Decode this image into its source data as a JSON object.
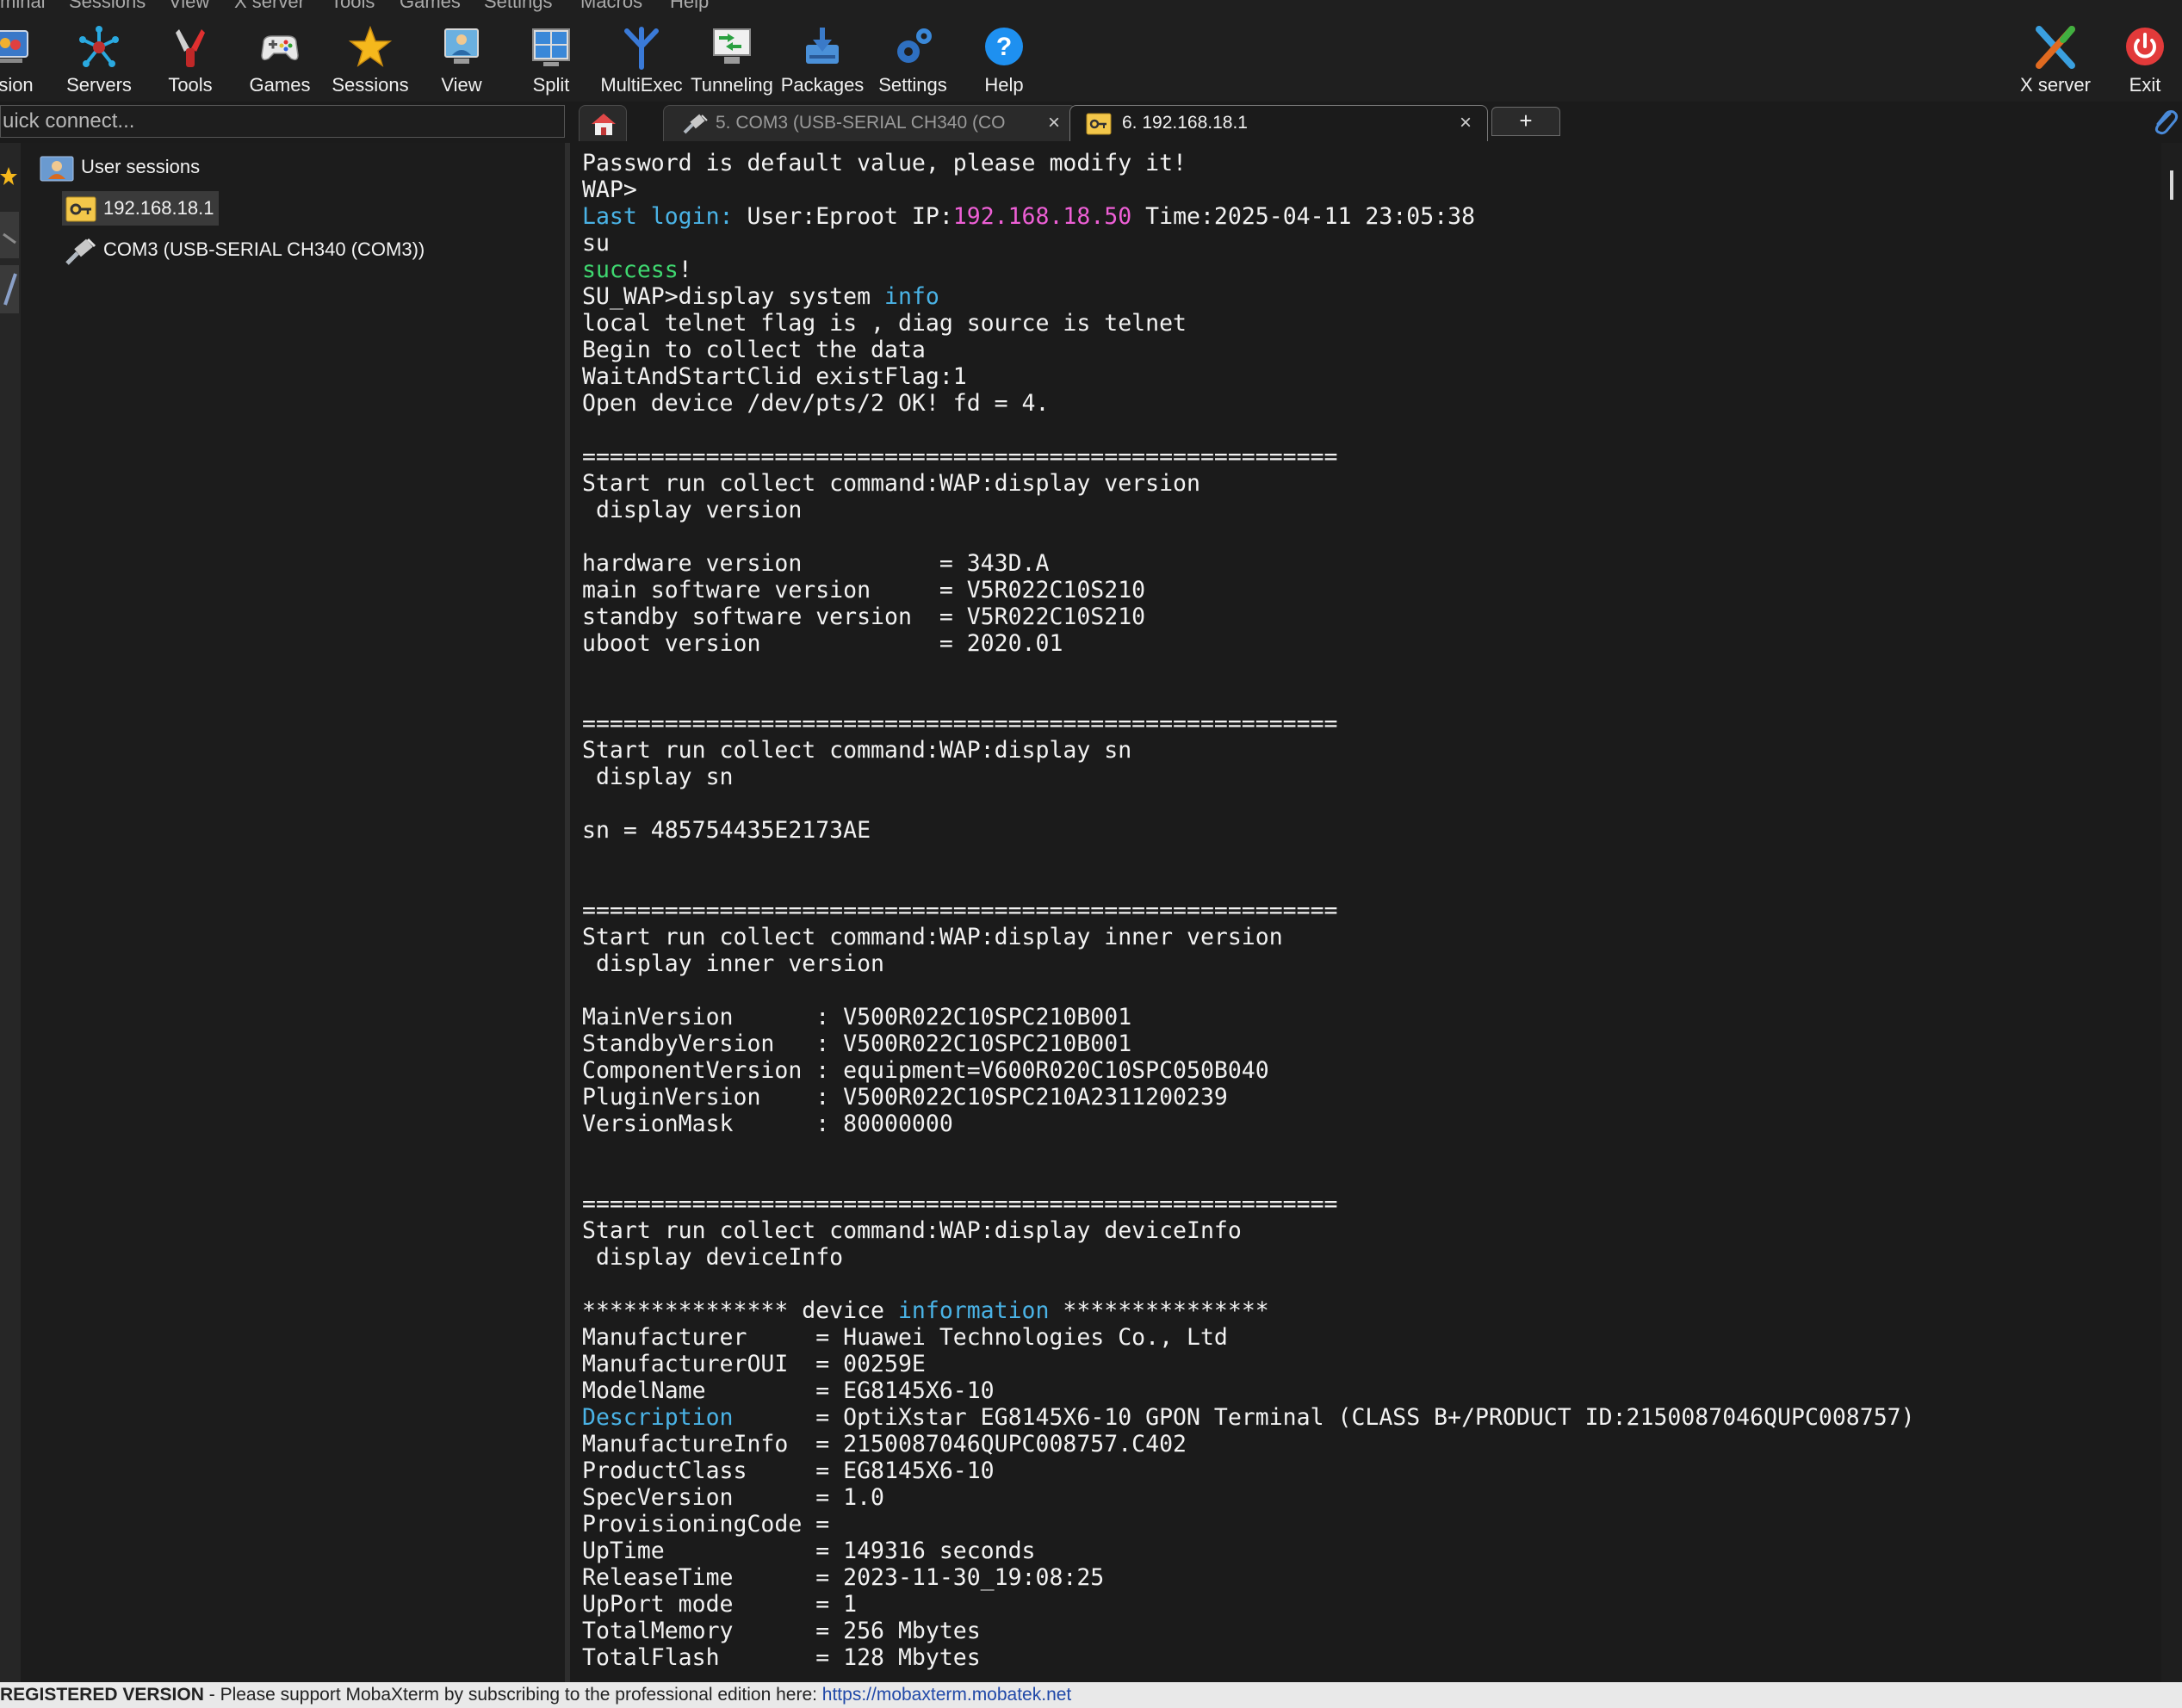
{
  "menu": [
    "minal",
    "Sessions",
    "View",
    "X server",
    "Tools",
    "Games",
    "Settings",
    "Macros",
    "Help"
  ],
  "toolbar": {
    "items": [
      {
        "label": "ssion",
        "icon": "session-icon"
      },
      {
        "label": "Servers",
        "icon": "servers-icon"
      },
      {
        "label": "Tools",
        "icon": "tools-icon"
      },
      {
        "label": "Games",
        "icon": "games-icon"
      },
      {
        "label": "Sessions",
        "icon": "star-icon"
      },
      {
        "label": "View",
        "icon": "view-icon"
      },
      {
        "label": "Split",
        "icon": "split-icon"
      },
      {
        "label": "MultiExec",
        "icon": "multiexec-icon"
      },
      {
        "label": "Tunneling",
        "icon": "tunneling-icon"
      },
      {
        "label": "Packages",
        "icon": "packages-icon"
      },
      {
        "label": "Settings",
        "icon": "settings-icon"
      },
      {
        "label": "Help",
        "icon": "help-icon"
      }
    ],
    "right": [
      {
        "label": "X server",
        "icon": "x-server-icon"
      },
      {
        "label": "Exit",
        "icon": "power-icon"
      }
    ]
  },
  "quick_connect": {
    "placeholder": "uick connect..."
  },
  "tabs": [
    {
      "label": "5. COM3  (USB-SERIAL CH340 (CO",
      "close": "×",
      "active": false
    },
    {
      "label": "6. 192.168.18.1",
      "close": "×",
      "active": true
    }
  ],
  "tab_plus": "+",
  "sidebar": {
    "root": "User sessions",
    "items": [
      {
        "label": "192.168.18.1",
        "selected": true
      },
      {
        "label": "COM3  (USB-SERIAL CH340 (COM3))",
        "selected": false
      }
    ]
  },
  "terminal": {
    "lines": [
      [
        {
          "t": "Password is default value, please modify it!"
        }
      ],
      [
        {
          "t": "WAP>"
        }
      ],
      [
        {
          "t": "Last login:",
          "c": "label"
        },
        {
          "t": " User:Eproot IP:"
        },
        {
          "t": "192.168.18.50",
          "c": "ip"
        },
        {
          "t": " Time:2025-04-11 23:05:38"
        }
      ],
      [
        {
          "t": "su"
        }
      ],
      [
        {
          "t": "success",
          "c": "green"
        },
        {
          "t": "!"
        }
      ],
      [
        {
          "t": "SU_WAP>display system "
        },
        {
          "t": "info",
          "c": "label"
        }
      ],
      [
        {
          "t": "local telnet flag is , diag source is telnet"
        }
      ],
      [
        {
          "t": "Begin to collect the data"
        }
      ],
      [
        {
          "t": "WaitAndStartClid existFlag:1"
        }
      ],
      [
        {
          "t": "Open device /dev/pts/2 OK! fd = 4."
        }
      ],
      [
        {
          "t": ""
        }
      ],
      [
        {
          "t": "======================================================="
        }
      ],
      [
        {
          "t": "Start run collect command:WAP:display version"
        }
      ],
      [
        {
          "t": " display version"
        }
      ],
      [
        {
          "t": ""
        }
      ],
      [
        {
          "t": "hardware version          = 343D.A"
        }
      ],
      [
        {
          "t": "main software version     = V5R022C10S210"
        }
      ],
      [
        {
          "t": "standby software version  = V5R022C10S210"
        }
      ],
      [
        {
          "t": "uboot version             = 2020.01"
        }
      ],
      [
        {
          "t": ""
        }
      ],
      [
        {
          "t": ""
        }
      ],
      [
        {
          "t": "======================================================="
        }
      ],
      [
        {
          "t": "Start run collect command:WAP:display sn"
        }
      ],
      [
        {
          "t": " display sn"
        }
      ],
      [
        {
          "t": ""
        }
      ],
      [
        {
          "t": "sn = 485754435E2173AE"
        }
      ],
      [
        {
          "t": ""
        }
      ],
      [
        {
          "t": ""
        }
      ],
      [
        {
          "t": "======================================================="
        }
      ],
      [
        {
          "t": "Start run collect command:WAP:display inner version"
        }
      ],
      [
        {
          "t": " display inner version"
        }
      ],
      [
        {
          "t": ""
        }
      ],
      [
        {
          "t": "MainVersion      : V500R022C10SPC210B001"
        }
      ],
      [
        {
          "t": "StandbyVersion   : V500R022C10SPC210B001"
        }
      ],
      [
        {
          "t": "ComponentVersion : equipment=V600R020C10SPC050B040"
        }
      ],
      [
        {
          "t": "PluginVersion    : V500R022C10SPC210A2311200239"
        }
      ],
      [
        {
          "t": "VersionMask      : 80000000"
        }
      ],
      [
        {
          "t": ""
        }
      ],
      [
        {
          "t": ""
        }
      ],
      [
        {
          "t": "======================================================="
        }
      ],
      [
        {
          "t": "Start run collect command:WAP:display deviceInfo"
        }
      ],
      [
        {
          "t": " display deviceInfo"
        }
      ],
      [
        {
          "t": ""
        }
      ],
      [
        {
          "t": "*************** device "
        },
        {
          "t": "information",
          "c": "label"
        },
        {
          "t": " ***************"
        }
      ],
      [
        {
          "t": "Manufacturer     = Huawei Technologies Co., Ltd"
        }
      ],
      [
        {
          "t": "ManufacturerOUI  = 00259E"
        }
      ],
      [
        {
          "t": "ModelName        = EG8145X6-10"
        }
      ],
      [
        {
          "t": "Description",
          "c": "label"
        },
        {
          "t": "      = OptiXstar EG8145X6-10 GPON Terminal (CLASS B+/PRODUCT ID:2150087046QUPC008757)"
        }
      ],
      [
        {
          "t": "ManufactureInfo  = 2150087046QUPC008757.C402"
        }
      ],
      [
        {
          "t": "ProductClass     = EG8145X6-10"
        }
      ],
      [
        {
          "t": "SpecVersion      = 1.0"
        }
      ],
      [
        {
          "t": "ProvisioningCode ="
        }
      ],
      [
        {
          "t": "UpTime           = 149316 seconds"
        }
      ],
      [
        {
          "t": "ReleaseTime      = 2023-11-30_19:08:25"
        }
      ],
      [
        {
          "t": "UpPort mode      = 1"
        }
      ],
      [
        {
          "t": "TotalMemory      = 256 Mbytes"
        }
      ],
      [
        {
          "t": "TotalFlash       = 128 Mbytes"
        }
      ]
    ]
  },
  "statusbar": {
    "registered": "REGISTERED VERSION",
    "separator": " - ",
    "message": " Please support MobaXterm by subscribing to the professional edition here: ",
    "link": "https://mobaxterm.mobatek.net"
  },
  "colors": {
    "label": "#4ab3e6",
    "ip": "#ee5fd6",
    "green": "#3fd870"
  }
}
